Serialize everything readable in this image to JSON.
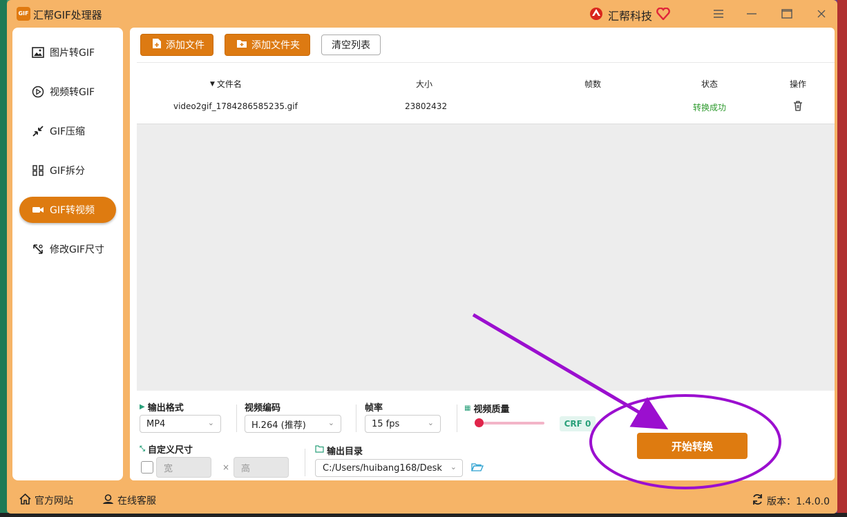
{
  "app": {
    "logo_text": "GIF",
    "title": "汇帮GIF处理器",
    "brand": "汇帮科技"
  },
  "sidebar": {
    "items": [
      {
        "label": "图片转GIF",
        "icon": "image-icon",
        "active": false
      },
      {
        "label": "视频转GIF",
        "icon": "play-icon",
        "active": false
      },
      {
        "label": "GIF压缩",
        "icon": "compress-icon",
        "active": false
      },
      {
        "label": "GIF拆分",
        "icon": "split-icon",
        "active": false
      },
      {
        "label": "GIF转视频",
        "icon": "video-camera-icon",
        "active": true
      },
      {
        "label": "修改GIF尺寸",
        "icon": "resize-icon",
        "active": false
      }
    ]
  },
  "toolbar": {
    "add_file": "添加文件",
    "add_folder": "添加文件夹",
    "clear_list": "清空列表"
  },
  "table": {
    "columns": [
      "文件名",
      "大小",
      "帧数",
      "状态",
      "操作"
    ],
    "rows": [
      {
        "name": "video2gif_1784286585235.gif",
        "size": "23802432",
        "frames": "",
        "status": "转换成功"
      }
    ]
  },
  "settings": {
    "output_format_label": "输出格式",
    "output_format_value": "MP4",
    "video_codec_label": "视频编码",
    "video_codec_value": "H.264 (推荐)",
    "frame_rate_label": "帧率",
    "frame_rate_value": "15 fps",
    "quality_label": "视频质量",
    "crf_label": "CRF 0",
    "crf_value": 0,
    "custom_size_label": "自定义尺寸",
    "custom_size_checked": false,
    "width_placeholder": "宽",
    "height_placeholder": "高",
    "times": "×",
    "output_dir_label": "输出目录",
    "output_dir_value": "C:/Users/huibang168/Desk",
    "start_button": "开始转换"
  },
  "footer": {
    "website": "官方网站",
    "support": "在线客服",
    "version": "版本：1.4.0.0"
  },
  "colors": {
    "accent": "#de7b10",
    "window_bg": "#f6b467",
    "success": "#2d9a2d",
    "annotation": "#9b0fcf"
  }
}
